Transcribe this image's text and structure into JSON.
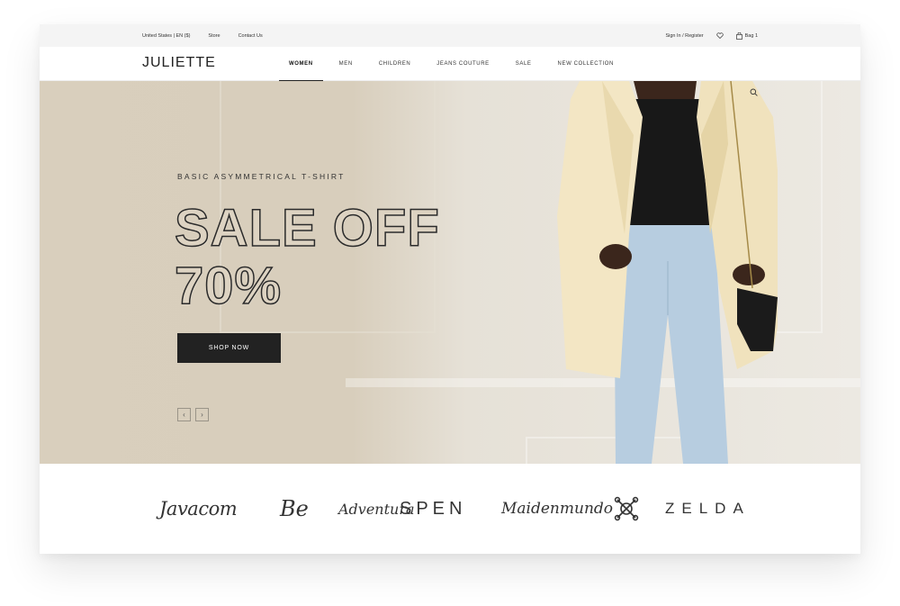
{
  "topbar": {
    "locale": "United States | EN ($)",
    "store": "Store",
    "contact": "Contact Us",
    "sign_in": "Sign In / Register",
    "bag": "Bag 1"
  },
  "header": {
    "logo": "JULIETTE",
    "nav": [
      "WOMEN",
      "MEN",
      "CHILDREN",
      "JEANS COUTURE",
      "SALE",
      "NEW COLLECTION"
    ],
    "active_nav": "WOMEN"
  },
  "hero": {
    "subtitle": "BASIC ASYMMETRICAL T-SHIRT",
    "title_line1": "SALE OFF",
    "title_line2": "70%",
    "cta": "SHOP NOW",
    "prev": "‹",
    "next": "›"
  },
  "brands": [
    "Javacom",
    "Be",
    "Adventura",
    "SPEN",
    "Maidenmundo",
    "ZELDA"
  ],
  "colors": {
    "hero_bg": "#d9cfbd",
    "button_bg": "#222222",
    "accent_text": "#222222"
  },
  "icons": [
    "heart-icon",
    "bag-icon",
    "search-icon",
    "chevron-left-icon",
    "chevron-right-icon",
    "brand-logomark-icon"
  ]
}
